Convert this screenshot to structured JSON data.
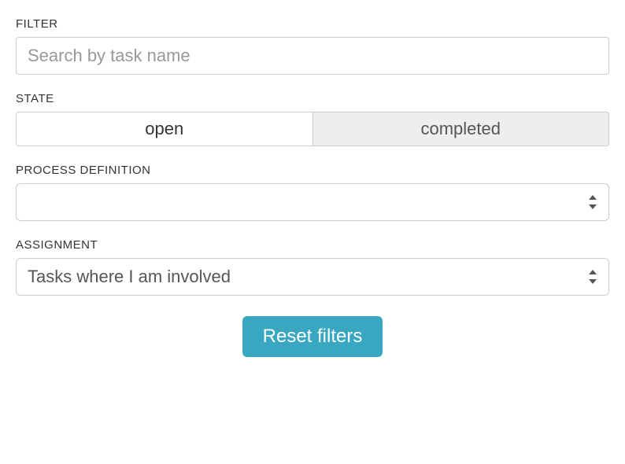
{
  "filter": {
    "label": "FILTER",
    "placeholder": "Search by task name",
    "value": ""
  },
  "state": {
    "label": "STATE",
    "options": [
      {
        "label": "open",
        "selected": true
      },
      {
        "label": "completed",
        "selected": false
      }
    ]
  },
  "process_definition": {
    "label": "PROCESS DEFINITION",
    "value": ""
  },
  "assignment": {
    "label": "ASSIGNMENT",
    "value": "Tasks where I am involved"
  },
  "actions": {
    "reset_label": "Reset filters"
  },
  "colors": {
    "primary": "#39a7c2",
    "border": "#ccc",
    "text": "#333",
    "muted_bg": "#eee"
  }
}
